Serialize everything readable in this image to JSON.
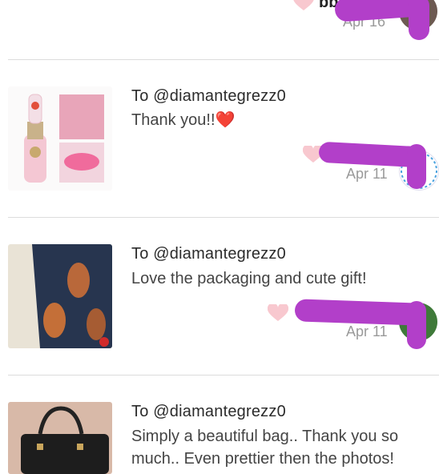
{
  "top_item": {
    "name_fragment": "bb",
    "date": "Apr 16"
  },
  "reviews": [
    {
      "to": "To @diamantegrezz0",
      "message": "Thank you!!❤️",
      "date": "Apr 11"
    },
    {
      "to": "To @diamantegrezz0",
      "message": "Love the packaging and cute gift!",
      "date": "Apr 11"
    },
    {
      "to": "To @diamantegrezz0",
      "message_line1": "Simply a beautiful bag.. Thank you so",
      "message_line2": "much.. Even prettier then the photos!"
    }
  ],
  "colors": {
    "redaction": "#b23fc9",
    "heart": "#f8c8cf",
    "divider": "#dcdcdc",
    "date": "#9a9a9a"
  }
}
